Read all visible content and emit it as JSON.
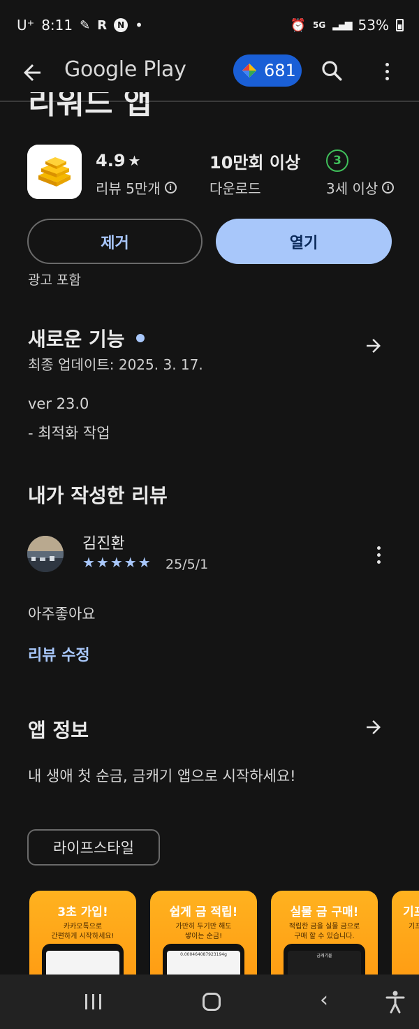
{
  "status_bar": {
    "carrier": "U⁺",
    "time": "8:11",
    "network": "5G",
    "battery": "53%"
  },
  "app_bar": {
    "brand": "Google Play",
    "points": "681"
  },
  "app": {
    "cut_title": "리워드 앱",
    "rating": "4.9",
    "reviews_label": "리뷰 5만개",
    "downloads": "10만회 이상",
    "downloads_label": "다운로드",
    "age_badge": "3",
    "age_label": "3세 이상",
    "remove_label": "제거",
    "open_label": "열기",
    "ads_label": "광고 포함"
  },
  "whats_new": {
    "title": "새로운 기능",
    "updated": "최종 업데이트: 2025. 3. 17.",
    "version": "ver 23.0",
    "note": "- 최적화 작업"
  },
  "my_review": {
    "title": "내가 작성한 리뷰",
    "reviewer": "김진환",
    "stars": "★★★★★",
    "rating_value": 5,
    "date": "25/5/1",
    "text": "아주좋아요",
    "edit_label": "리뷰 수정"
  },
  "about": {
    "title": "앱 정보",
    "description": "내 생애 첫 순금, 금캐기 앱으로 시작하세요!",
    "category": "라이프스타일"
  },
  "screenshots": [
    {
      "headline": "3초 가입!",
      "sub": "카카오톡으로\n간편하게 시작하세요!",
      "screen_text": ""
    },
    {
      "headline": "쉽게 금 적립!",
      "sub": "가만히 두기만 해도\n쌓이는 순금!",
      "screen_text": "0.000464087923194g"
    },
    {
      "headline": "실물 금 구매!",
      "sub": "적립한 금을 실물 금으로\n구매 할 수 있습니다.",
      "screen_text": "금캐기몰"
    },
    {
      "headline": "기프",
      "sub": "기프",
      "screen_text": ""
    }
  ],
  "colors": {
    "background": "#141414",
    "accent": "#a8c7fa",
    "points_pill": "#1a5fd6",
    "age_green": "#3fbf5a",
    "screenshot_orange": "#ffa61a"
  }
}
